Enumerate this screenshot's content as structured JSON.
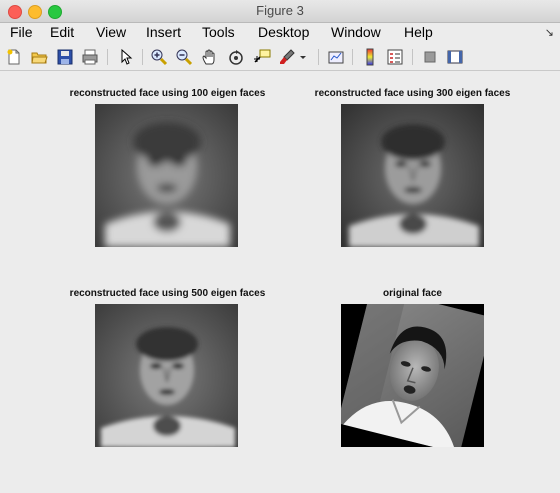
{
  "window": {
    "title": "Figure 3"
  },
  "menu": {
    "items": [
      "File",
      "Edit",
      "View",
      "Insert",
      "Tools",
      "Desktop",
      "Window",
      "Help"
    ],
    "overflow_arrow": "↘"
  },
  "toolbar": {
    "icons": [
      "new-figure-icon",
      "open-file-icon",
      "save-icon",
      "print-icon",
      "pointer-icon",
      "zoom-in-icon",
      "zoom-out-icon",
      "pan-hand-icon",
      "rotate-3d-icon",
      "data-cursor-icon",
      "brush-icon",
      "dropdown-arrow-icon",
      "link-plot-icon",
      "colorbar-icon",
      "legend-icon",
      "hide-plot-tools-icon",
      "show-plot-tools-icon"
    ]
  },
  "subplots": [
    {
      "title": "reconstructed face using 100 eigen faces"
    },
    {
      "title": "reconstructed face using 300 eigen faces"
    },
    {
      "title": "reconstructed face using 500 eigen faces"
    },
    {
      "title": "original face"
    }
  ]
}
